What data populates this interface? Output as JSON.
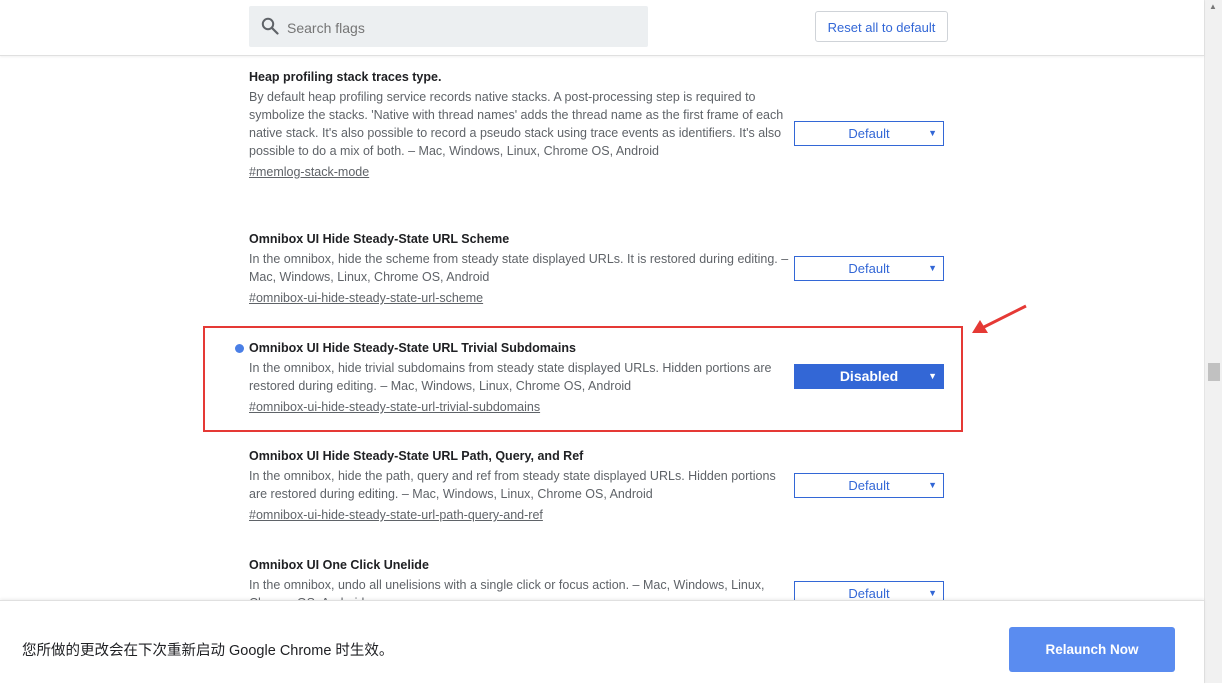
{
  "header": {
    "search_placeholder": "Search flags",
    "reset_label": "Reset all to default"
  },
  "flags": [
    {
      "title": "Heap profiling stack traces type.",
      "description": "By default heap profiling service records native stacks. A post-processing step is required to symbolize the stacks. 'Native with thread names' adds the thread name as the first frame of each native stack. It's also possible to record a pseudo stack using trace events as identifiers. It's also possible to do a mix of both. – Mac, Windows, Linux, Chrome OS, Android",
      "link": "#memlog-stack-mode",
      "value": "Default"
    },
    {
      "title": "Omnibox UI Hide Steady-State URL Scheme",
      "description": "In the omnibox, hide the scheme from steady state displayed URLs. It is restored during editing. – Mac, Windows, Linux, Chrome OS, Android",
      "link": "#omnibox-ui-hide-steady-state-url-scheme",
      "value": "Default"
    },
    {
      "title": "Omnibox UI Hide Steady-State URL Trivial Subdomains",
      "description": "In the omnibox, hide trivial subdomains from steady state displayed URLs. Hidden portions are restored during editing. – Mac, Windows, Linux, Chrome OS, Android",
      "link": "#omnibox-ui-hide-steady-state-url-trivial-subdomains",
      "value": "Disabled"
    },
    {
      "title": "Omnibox UI Hide Steady-State URL Path, Query, and Ref",
      "description": "In the omnibox, hide the path, query and ref from steady state displayed URLs. Hidden portions are restored during editing. – Mac, Windows, Linux, Chrome OS, Android",
      "link": "#omnibox-ui-hide-steady-state-url-path-query-and-ref",
      "value": "Default"
    },
    {
      "title": "Omnibox UI One Click Unelide",
      "description": "In the omnibox, undo all unelisions with a single click or focus action. – Mac, Windows, Linux, Chrome OS, Android",
      "link": "",
      "value": "Default"
    }
  ],
  "footer": {
    "message": "您所做的更改会在下次重新启动 Google Chrome 时生效。",
    "relaunch_label": "Relaunch Now"
  },
  "colors": {
    "accent": "#3367d6",
    "relaunch": "#5a8cf0",
    "highlight": "#e53935",
    "modified_dot": "#4a7fe6"
  }
}
